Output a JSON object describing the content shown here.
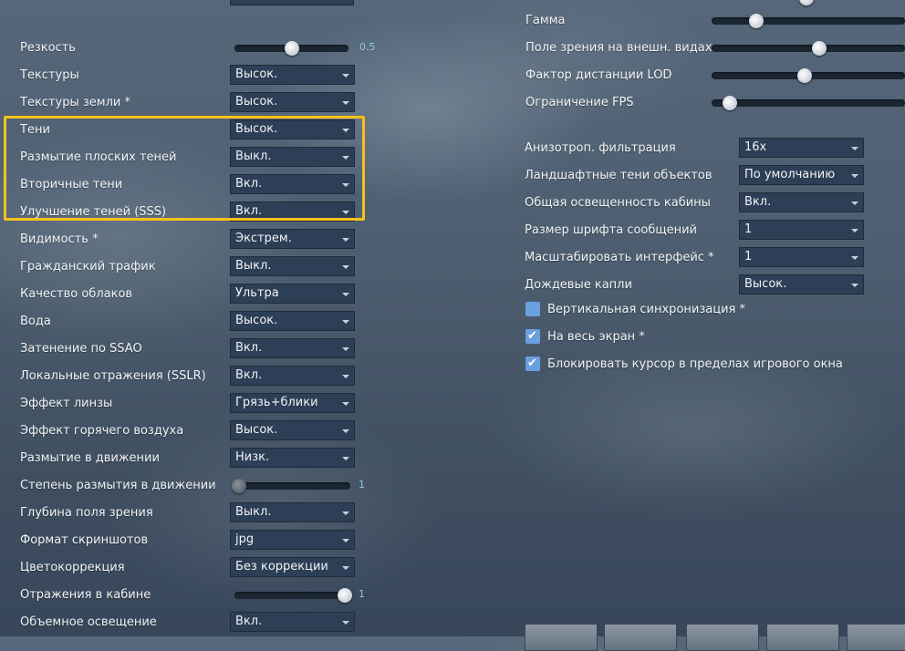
{
  "left": {
    "sharpness": {
      "label": "Резкость",
      "value": "0.5"
    },
    "rows": [
      {
        "label": "Текстуры",
        "value": "Высок."
      },
      {
        "label": "Текстуры земли *",
        "value": "Высок."
      },
      {
        "label": "Тени",
        "value": "Высок."
      },
      {
        "label": "Размытие плоских теней",
        "value": "Выкл."
      },
      {
        "label": "Вторичные тени",
        "value": "Вкл."
      },
      {
        "label": "Улучшение теней (SSS)",
        "value": "Вкл."
      },
      {
        "label": "Видимость *",
        "value": "Экстрем."
      },
      {
        "label": "Гражданский трафик",
        "value": "Выкл."
      },
      {
        "label": "Качество облаков",
        "value": "Ультра"
      },
      {
        "label": "Вода",
        "value": "Высок."
      },
      {
        "label": "Затенение по SSAO",
        "value": "Вкл."
      },
      {
        "label": "Локальные отражения (SSLR)",
        "value": "Вкл."
      },
      {
        "label": "Эффект линзы",
        "value": "Грязь+блики"
      },
      {
        "label": "Эффект горячего воздуха",
        "value": "Высок."
      },
      {
        "label": "Размытие в движении",
        "value": "Низк."
      }
    ],
    "motion_blur_strength": {
      "label": "Степень размытия в движении",
      "value": "1"
    },
    "rows2": [
      {
        "label": "Глубина поля зрения",
        "value": "Выкл."
      },
      {
        "label": "Формат скриншотов",
        "value": "jpg"
      },
      {
        "label": "Цветокоррекция",
        "value": "Без коррекции"
      }
    ],
    "cockpit_reflections": {
      "label": "Отражения в кабине",
      "value": "1"
    },
    "volumetric": {
      "label": "Объемное освещение",
      "value": "Вкл."
    }
  },
  "right": {
    "sliders": [
      {
        "label": "Гамма",
        "level": 0.2
      },
      {
        "label": "Поле зрения на внешн. видах",
        "level": 0.55
      },
      {
        "label": "Фактор дистанции LOD",
        "level": 0.47
      },
      {
        "label": "Ограничение FPS",
        "level": 0.05
      }
    ],
    "rows": [
      {
        "label": "Анизотроп. фильтрация",
        "value": "16x"
      },
      {
        "label": "Ландшафтные тени объектов",
        "value": "По умолчанию"
      },
      {
        "label": "Общая освещенность кабины",
        "value": "Вкл."
      },
      {
        "label": "Размер шрифта сообщений",
        "value": "1"
      },
      {
        "label": "Масштабировать интерфейс *",
        "value": "1"
      },
      {
        "label": "Дождевые капли",
        "value": "Высок."
      }
    ],
    "checkboxes": [
      {
        "label": "Вертикальная синхронизация *",
        "checked": false
      },
      {
        "label": "На весь экран *",
        "checked": true
      },
      {
        "label": "Блокировать курсор в пределах игрового окна",
        "checked": true
      }
    ]
  },
  "levels": {
    "sharpness": 0.5,
    "motion_blur_strength": 0.0,
    "cockpit_reflections": 1.0
  },
  "highlight_color": "#f5c21a",
  "icons": {
    "dropdown": "chevron-down-icon",
    "check": "checkmark-icon"
  }
}
